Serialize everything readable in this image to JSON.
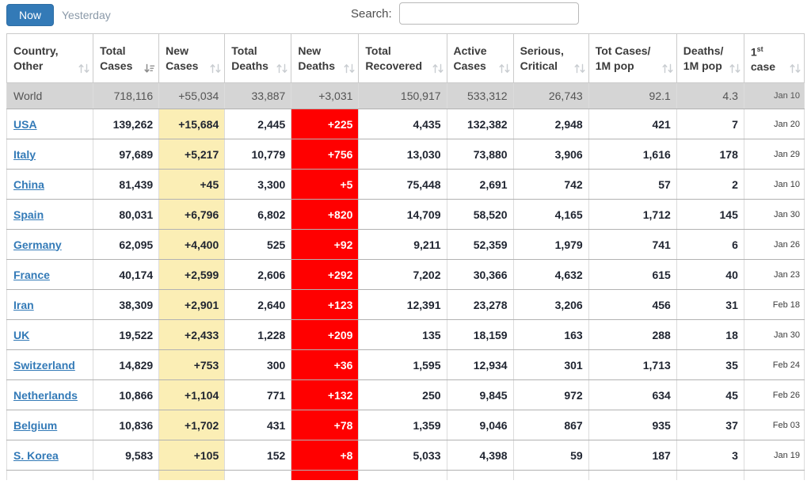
{
  "toolbar": {
    "now_label": "Now",
    "yesterday_label": "Yesterday",
    "search_label": "Search:",
    "search_value": "",
    "accent_color": "#337ab7"
  },
  "table": {
    "colors": {
      "new_cases_bg": "#fbeeb5",
      "new_deaths_bg": "#ff0000",
      "world_row_bg": "#d5d5d5",
      "link_color": "#337ab7"
    },
    "columns": [
      {
        "key": "country",
        "label_lines": [
          "Country,",
          "Other"
        ],
        "sort": "both",
        "align": "left"
      },
      {
        "key": "total_cases",
        "label_lines": [
          "Total",
          "Cases"
        ],
        "sort": "desc",
        "align": "right"
      },
      {
        "key": "new_cases",
        "label_lines": [
          "New",
          "Cases"
        ],
        "sort": "both",
        "align": "right",
        "highlight": "yellow"
      },
      {
        "key": "total_deaths",
        "label_lines": [
          "Total",
          "Deaths"
        ],
        "sort": "both",
        "align": "right"
      },
      {
        "key": "new_deaths",
        "label_lines": [
          "New",
          "Deaths"
        ],
        "sort": "both",
        "align": "right",
        "highlight": "red"
      },
      {
        "key": "total_recovered",
        "label_lines": [
          "Total",
          "Recovered"
        ],
        "sort": "both",
        "align": "right"
      },
      {
        "key": "active_cases",
        "label_lines": [
          "Active",
          "Cases"
        ],
        "sort": "both",
        "align": "right"
      },
      {
        "key": "serious_critical",
        "label_lines": [
          "Serious,",
          "Critical"
        ],
        "sort": "both",
        "align": "right"
      },
      {
        "key": "cases_per_1m",
        "label_lines": [
          "Tot Cases/",
          "1M pop"
        ],
        "sort": "both",
        "align": "right"
      },
      {
        "key": "deaths_per_1m",
        "label_lines": [
          "Deaths/",
          "1M pop"
        ],
        "sort": "both",
        "align": "right"
      },
      {
        "key": "first_case",
        "label_lines": [
          "1st",
          "case"
        ],
        "sort": "both",
        "align": "right",
        "sup": {
          "line": 0,
          "base": "1",
          "sup": "st"
        }
      }
    ],
    "world_row": {
      "country": "World",
      "total_cases": "718,116",
      "new_cases": "+55,034",
      "total_deaths": "33,887",
      "new_deaths": "+3,031",
      "total_recovered": "150,917",
      "active_cases": "533,312",
      "serious_critical": "26,743",
      "cases_per_1m": "92.1",
      "deaths_per_1m": "4.3",
      "first_case": "Jan 10"
    },
    "rows": [
      {
        "country": "USA",
        "total_cases": "139,262",
        "new_cases": "+15,684",
        "total_deaths": "2,445",
        "new_deaths": "+225",
        "total_recovered": "4,435",
        "active_cases": "132,382",
        "serious_critical": "2,948",
        "cases_per_1m": "421",
        "deaths_per_1m": "7",
        "first_case": "Jan 20"
      },
      {
        "country": "Italy",
        "total_cases": "97,689",
        "new_cases": "+5,217",
        "total_deaths": "10,779",
        "new_deaths": "+756",
        "total_recovered": "13,030",
        "active_cases": "73,880",
        "serious_critical": "3,906",
        "cases_per_1m": "1,616",
        "deaths_per_1m": "178",
        "first_case": "Jan 29"
      },
      {
        "country": "China",
        "total_cases": "81,439",
        "new_cases": "+45",
        "total_deaths": "3,300",
        "new_deaths": "+5",
        "total_recovered": "75,448",
        "active_cases": "2,691",
        "serious_critical": "742",
        "cases_per_1m": "57",
        "deaths_per_1m": "2",
        "first_case": "Jan 10"
      },
      {
        "country": "Spain",
        "total_cases": "80,031",
        "new_cases": "+6,796",
        "total_deaths": "6,802",
        "new_deaths": "+820",
        "total_recovered": "14,709",
        "active_cases": "58,520",
        "serious_critical": "4,165",
        "cases_per_1m": "1,712",
        "deaths_per_1m": "145",
        "first_case": "Jan 30"
      },
      {
        "country": "Germany",
        "total_cases": "62,095",
        "new_cases": "+4,400",
        "total_deaths": "525",
        "new_deaths": "+92",
        "total_recovered": "9,211",
        "active_cases": "52,359",
        "serious_critical": "1,979",
        "cases_per_1m": "741",
        "deaths_per_1m": "6",
        "first_case": "Jan 26"
      },
      {
        "country": "France",
        "total_cases": "40,174",
        "new_cases": "+2,599",
        "total_deaths": "2,606",
        "new_deaths": "+292",
        "total_recovered": "7,202",
        "active_cases": "30,366",
        "serious_critical": "4,632",
        "cases_per_1m": "615",
        "deaths_per_1m": "40",
        "first_case": "Jan 23"
      },
      {
        "country": "Iran",
        "total_cases": "38,309",
        "new_cases": "+2,901",
        "total_deaths": "2,640",
        "new_deaths": "+123",
        "total_recovered": "12,391",
        "active_cases": "23,278",
        "serious_critical": "3,206",
        "cases_per_1m": "456",
        "deaths_per_1m": "31",
        "first_case": "Feb 18"
      },
      {
        "country": "UK",
        "total_cases": "19,522",
        "new_cases": "+2,433",
        "total_deaths": "1,228",
        "new_deaths": "+209",
        "total_recovered": "135",
        "active_cases": "18,159",
        "serious_critical": "163",
        "cases_per_1m": "288",
        "deaths_per_1m": "18",
        "first_case": "Jan 30"
      },
      {
        "country": "Switzerland",
        "total_cases": "14,829",
        "new_cases": "+753",
        "total_deaths": "300",
        "new_deaths": "+36",
        "total_recovered": "1,595",
        "active_cases": "12,934",
        "serious_critical": "301",
        "cases_per_1m": "1,713",
        "deaths_per_1m": "35",
        "first_case": "Feb 24"
      },
      {
        "country": "Netherlands",
        "total_cases": "10,866",
        "new_cases": "+1,104",
        "total_deaths": "771",
        "new_deaths": "+132",
        "total_recovered": "250",
        "active_cases": "9,845",
        "serious_critical": "972",
        "cases_per_1m": "634",
        "deaths_per_1m": "45",
        "first_case": "Feb 26"
      },
      {
        "country": "Belgium",
        "total_cases": "10,836",
        "new_cases": "+1,702",
        "total_deaths": "431",
        "new_deaths": "+78",
        "total_recovered": "1,359",
        "active_cases": "9,046",
        "serious_critical": "867",
        "cases_per_1m": "935",
        "deaths_per_1m": "37",
        "first_case": "Feb 03"
      },
      {
        "country": "S. Korea",
        "total_cases": "9,583",
        "new_cases": "+105",
        "total_deaths": "152",
        "new_deaths": "+8",
        "total_recovered": "5,033",
        "active_cases": "4,398",
        "serious_critical": "59",
        "cases_per_1m": "187",
        "deaths_per_1m": "3",
        "first_case": "Jan 19"
      }
    ],
    "has_partial_next_row": true
  }
}
